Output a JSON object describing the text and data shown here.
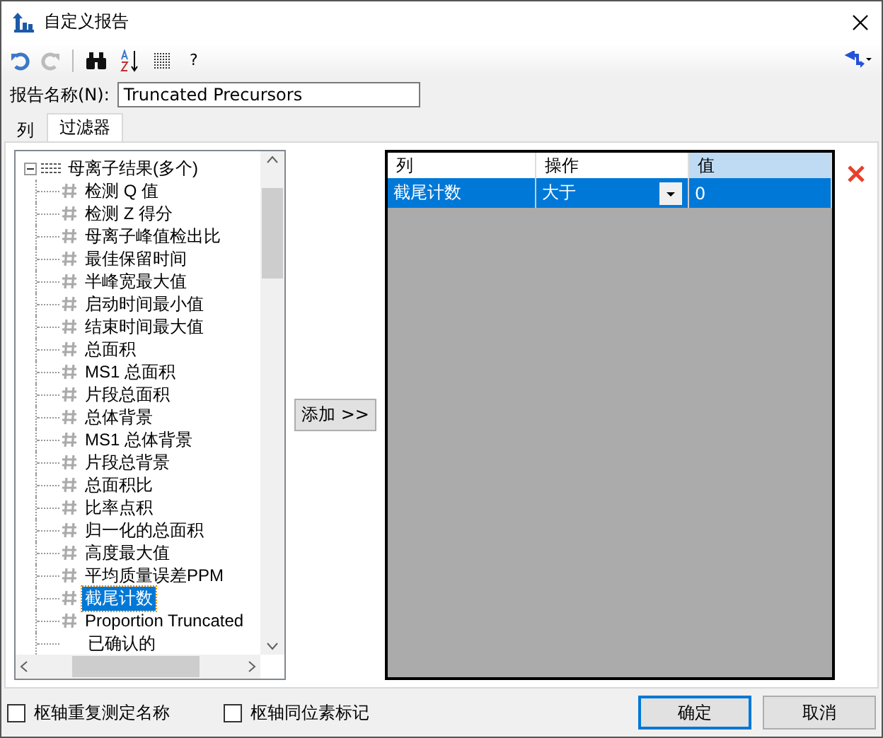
{
  "window": {
    "title": "自定义报告"
  },
  "toolbar": {
    "help": "?"
  },
  "report_name": {
    "label": "报告名称(N):",
    "value": "Truncated Precursors"
  },
  "tabs": [
    {
      "label": "列",
      "selected": false
    },
    {
      "label": "过滤器",
      "selected": true
    }
  ],
  "tree": {
    "label": "母离子结果(多个)",
    "expanded": true,
    "children": [
      {
        "label": "检测 Q 值",
        "kind": "number",
        "selected": false
      },
      {
        "label": "检测 Z 得分",
        "kind": "number",
        "selected": false
      },
      {
        "label": "母离子峰值检出比",
        "kind": "number",
        "selected": false
      },
      {
        "label": "最佳保留时间",
        "kind": "number",
        "selected": false
      },
      {
        "label": "半峰宽最大值",
        "kind": "number",
        "selected": false
      },
      {
        "label": "启动时间最小值",
        "kind": "number",
        "selected": false
      },
      {
        "label": "结束时间最大值",
        "kind": "number",
        "selected": false
      },
      {
        "label": "总面积",
        "kind": "number",
        "selected": false
      },
      {
        "label": "MS1 总面积",
        "kind": "number",
        "selected": false
      },
      {
        "label": "片段总面积",
        "kind": "number",
        "selected": false
      },
      {
        "label": "总体背景",
        "kind": "number",
        "selected": false
      },
      {
        "label": "MS1 总体背景",
        "kind": "number",
        "selected": false
      },
      {
        "label": "片段总背景",
        "kind": "number",
        "selected": false
      },
      {
        "label": "总面积比",
        "kind": "number",
        "selected": false
      },
      {
        "label": "比率点积",
        "kind": "number",
        "selected": false
      },
      {
        "label": "归一化的总面积",
        "kind": "number",
        "selected": false
      },
      {
        "label": "高度最大值",
        "kind": "number",
        "selected": false
      },
      {
        "label": "平均质量误差PPM",
        "kind": "number",
        "selected": false
      },
      {
        "label": "截尾计数",
        "kind": "number",
        "selected": true
      },
      {
        "label": "Proportion Truncated",
        "kind": "number",
        "selected": false
      },
      {
        "label": "已确认的",
        "kind": "flag",
        "selected": false
      }
    ]
  },
  "add_button": "添加 >>",
  "filter_table": {
    "columns": [
      "列",
      "操作",
      "值"
    ],
    "rows": [
      {
        "column": "截尾计数",
        "operation": "大于",
        "value": "0",
        "selected": true
      }
    ]
  },
  "options": [
    {
      "label": "枢轴重复测定名称",
      "checked": false
    },
    {
      "label": "枢轴同位素标记",
      "checked": false
    }
  ],
  "buttons": [
    {
      "label": "确定",
      "default": true
    },
    {
      "label": "取消",
      "default": false
    }
  ]
}
